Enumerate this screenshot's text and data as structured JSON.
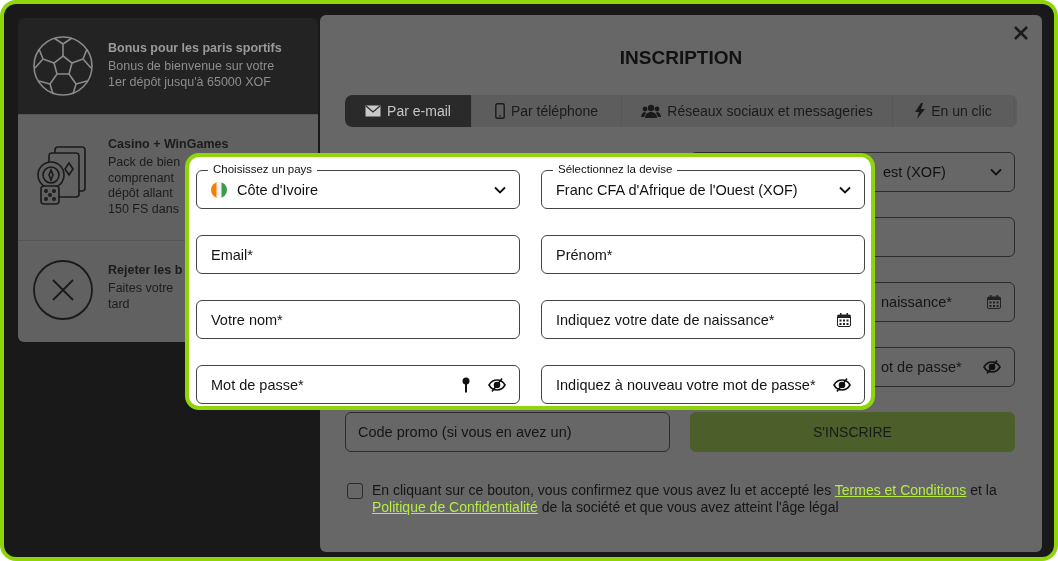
{
  "bonus_panel": {
    "items": [
      {
        "kind": "sports",
        "selected": true,
        "title": "Bonus pour les paris sportifs",
        "text": "Bonus de bienvenue sur votre\n1er dépôt jusqu'à 65000 XOF"
      },
      {
        "kind": "casino",
        "selected": false,
        "title": "Casino + WinGames",
        "text": "Pack de bien\ncomprenant\ndépôt allant\n150 FS dans"
      },
      {
        "kind": "reject",
        "selected": false,
        "title": "Rejeter les b",
        "text": "Faites votre\ntard"
      }
    ]
  },
  "modal": {
    "title": "INSCRIPTION",
    "tabs": [
      {
        "kind": "email",
        "label": "Par e-mail",
        "selected": true
      },
      {
        "kind": "phone",
        "label": "Par téléphone",
        "selected": false
      },
      {
        "kind": "social",
        "label": "Réseaux sociaux et messageries",
        "selected": false
      },
      {
        "kind": "oneclick",
        "label": "En un clic",
        "selected": false
      }
    ],
    "form_fields": [
      {
        "kind": "select",
        "value": "est (XOF)"
      },
      {
        "kind": "text"
      },
      {
        "kind": "date",
        "placeholder": "naissance*"
      },
      {
        "kind": "password",
        "placeholder": "ot de passe*"
      }
    ],
    "promo_code": {
      "placeholder": "Code promo (si vous en avez un)"
    },
    "submit_button": "S'INSCRIRE",
    "consent": {
      "checked": false,
      "text_before": "En cliquant sur ce bouton, vous confirmez que vous avez lu et accepté les",
      "terms_link": "Termes et Conditions",
      "middle": "et la",
      "privacy_link": "Politique de Confidentialité",
      "text_after": "de la société et que vous avez atteint l'âge légal"
    }
  },
  "zoom_callout": {
    "fields": [
      {
        "kind": "country",
        "label": "Choisissez un pays",
        "value": "Côte d'Ivoire"
      },
      {
        "kind": "currency",
        "label": "Sélectionnez la devise",
        "value": "Franc CFA d'Afrique de l'Ouest (XOF)"
      },
      {
        "kind": "text",
        "placeholder": "Email*"
      },
      {
        "kind": "text",
        "placeholder": "Prénom*"
      },
      {
        "kind": "text",
        "placeholder": "Votre nom*"
      },
      {
        "kind": "date",
        "placeholder": "Indiquez votre date de naissance*"
      },
      {
        "kind": "password",
        "placeholder": "Mot de passe*"
      },
      {
        "kind": "confirm",
        "placeholder": "Indiquez à nouveau votre mot de passe*"
      }
    ]
  }
}
